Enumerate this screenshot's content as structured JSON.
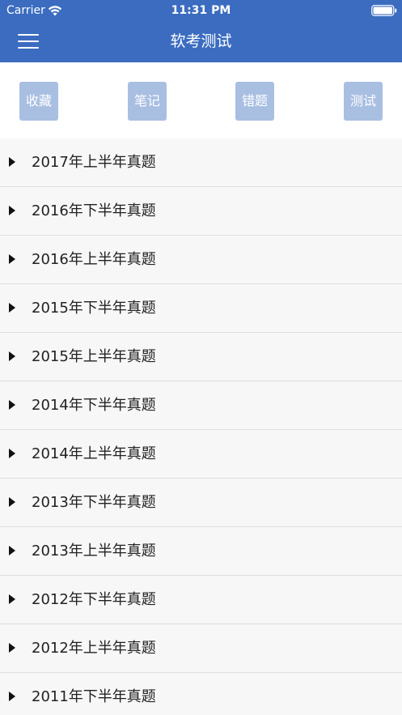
{
  "status_bar": {
    "carrier": "Carrier",
    "time": "11:31 PM"
  },
  "nav": {
    "title": "软考测试",
    "menu_icon": "hamburger-menu-icon"
  },
  "tabs": [
    {
      "label": "收藏"
    },
    {
      "label": "笔记"
    },
    {
      "label": "错题"
    },
    {
      "label": "测试"
    }
  ],
  "exam_list": [
    {
      "label": "2017年上半年真题"
    },
    {
      "label": "2016年下半年真题"
    },
    {
      "label": "2016年上半年真题"
    },
    {
      "label": "2015年下半年真题"
    },
    {
      "label": "2015年上半年真题"
    },
    {
      "label": "2014年下半年真题"
    },
    {
      "label": "2014年上半年真题"
    },
    {
      "label": "2013年下半年真题"
    },
    {
      "label": "2013年上半年真题"
    },
    {
      "label": "2012年下半年真题"
    },
    {
      "label": "2012年上半年真题"
    },
    {
      "label": "2011年下半年真题"
    }
  ],
  "colors": {
    "header": "#3b6cc0",
    "tab_button": "#a9bfe2",
    "list_background": "#f7f7f7",
    "divider": "#dedede"
  }
}
